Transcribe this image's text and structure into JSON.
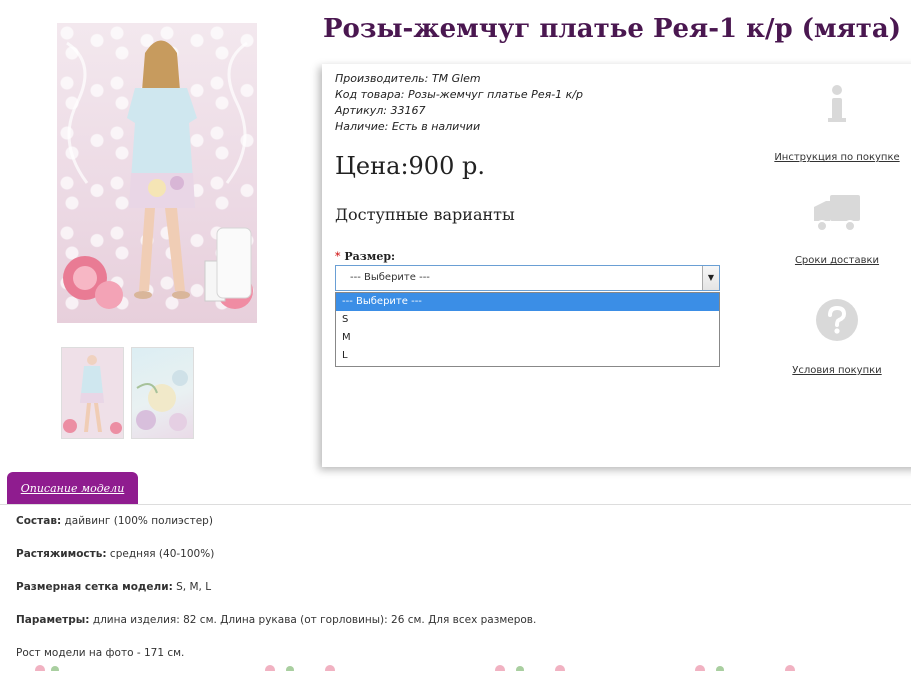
{
  "product": {
    "title": "Розы-жемчуг платье Рея-1 к/р (мята)",
    "meta": [
      {
        "key": "Производитель:",
        "value": "ТМ Glem"
      },
      {
        "key": "Код товара:",
        "value": "Розы-жемчуг платье Рея-1 к/р"
      },
      {
        "key": "Артикул:",
        "value": "33167"
      },
      {
        "key": "Наличие:",
        "value": "Есть в наличии"
      }
    ],
    "price": "Цена:900 р.",
    "variants_heading": "Доступные варианты",
    "size": {
      "required_mark": "*",
      "label": "Размер:",
      "selected": "--- Выберите ---",
      "options": [
        "--- Выберите ---",
        "S",
        "M",
        "L"
      ]
    }
  },
  "side_links": [
    {
      "label": "Инструкция по покупке",
      "icon": "info-icon"
    },
    {
      "label": "Сроки доставки",
      "icon": "truck-icon"
    },
    {
      "label": "Условия покупки",
      "icon": "question-icon"
    }
  ],
  "tabs": {
    "description": "Описание модели"
  },
  "description": [
    {
      "label": "Состав:",
      "text": " дайвинг (100% полиэстер)"
    },
    {
      "label": "Растяжимость:",
      "text": " средняя (40-100%)"
    },
    {
      "label": "Размерная сетка модели:",
      "text": " S, M, L"
    },
    {
      "label": "Параметры:",
      "text": " длина изделия: 82 см. Длина рукава (от горловины): 26 см. Для всех размеров."
    },
    {
      "label": "",
      "text": "Рост модели на фото - 171 см."
    }
  ],
  "colors": {
    "title": "#4a1750",
    "tab": "#8f1c8f",
    "dropdown_selected": "#3b8ee6"
  }
}
